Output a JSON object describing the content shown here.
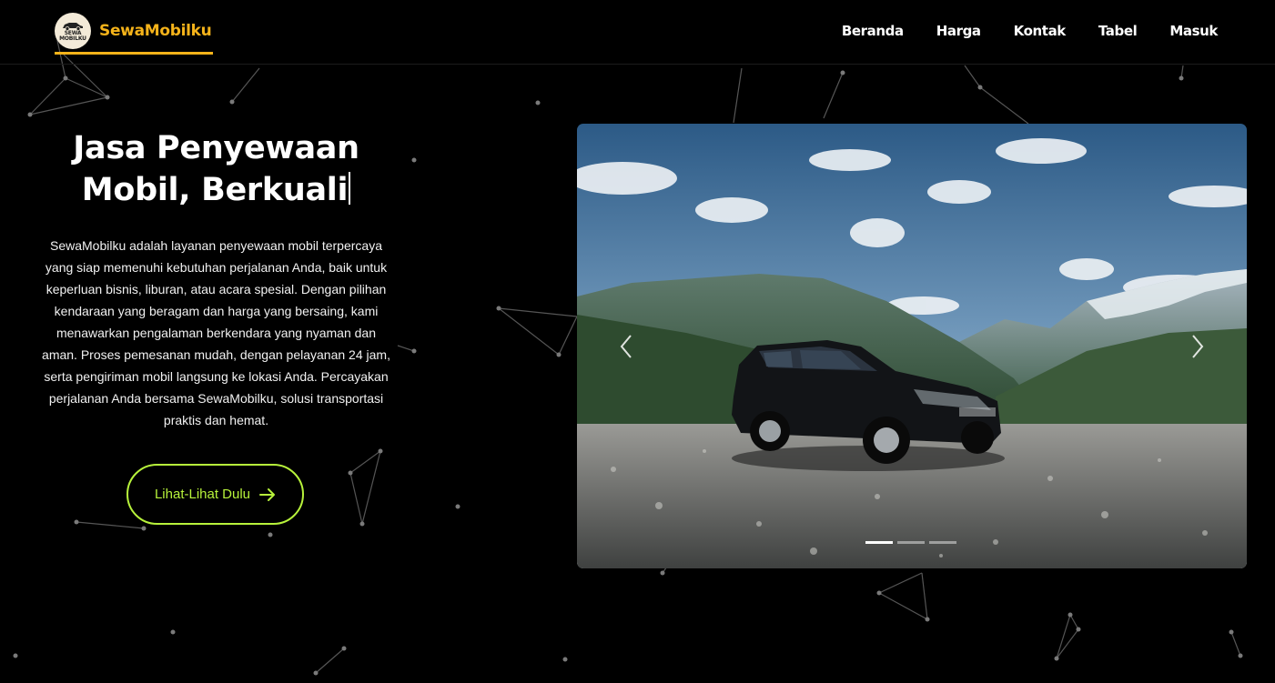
{
  "brand": {
    "name": "SewaMobilku",
    "logo_text_line1": "SEWA",
    "logo_text_line2": "MOBILKU",
    "accent_color": "#f5b31a"
  },
  "nav": {
    "items": [
      {
        "label": "Beranda"
      },
      {
        "label": "Harga"
      },
      {
        "label": "Kontak"
      },
      {
        "label": "Tabel"
      },
      {
        "label": "Masuk"
      }
    ]
  },
  "hero": {
    "title_line1": "Jasa Penyewaan",
    "title_line2": "Mobil, Berkuali",
    "description": "SewaMobilku adalah layanan penyewaan mobil terpercaya yang siap memenuhi kebutuhan perjalanan Anda, baik untuk keperluan bisnis, liburan, atau acara spesial. Dengan pilihan kendaraan yang beragam dan harga yang bersaing, kami menawarkan pengalaman berkendara yang nyaman dan aman. Proses pemesanan mudah, dengan pelayanan 24 jam, serta pengiriman mobil langsung ke lokasi Anda. Percayakan perjalanan Anda bersama SewaMobilku, solusi transportasi praktis dan hemat.",
    "cta_label": "Lihat-Lihat Dulu",
    "cta_icon": "arrow-right-icon",
    "cta_color": "#b7f23b"
  },
  "carousel": {
    "slide_count": 3,
    "active_index": 0,
    "slide_description": "black SUV on gravel with mountains and cloudy sky",
    "prev_icon": "chevron-left-icon",
    "next_icon": "chevron-right-icon"
  }
}
